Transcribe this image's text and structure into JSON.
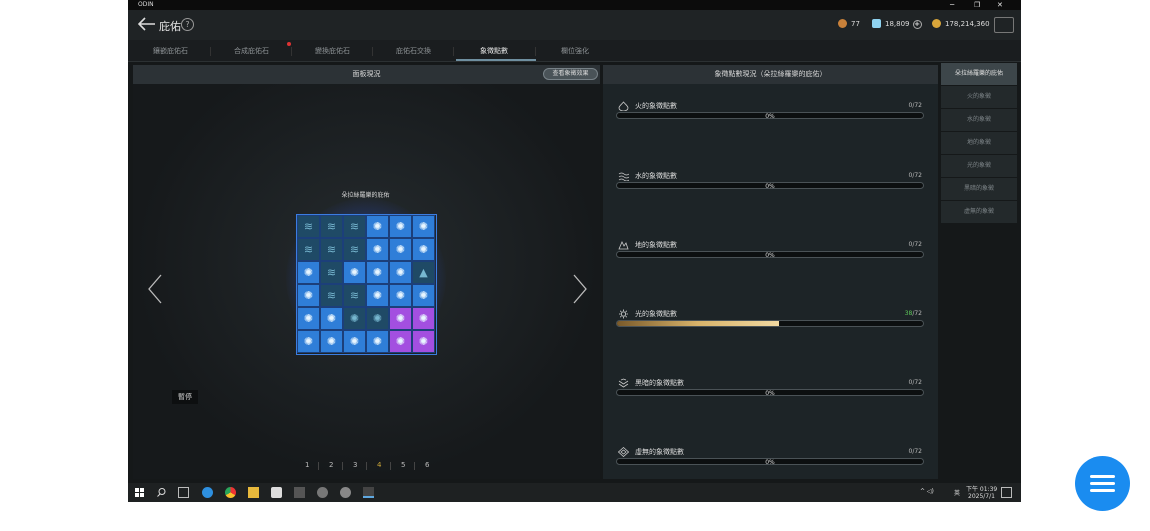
{
  "window": {
    "app_title": "ODIN",
    "min": "─",
    "restore": "❐",
    "close": "✕"
  },
  "header": {
    "title": "庇佑",
    "help": "?"
  },
  "currency": {
    "ore": "77",
    "diamond": "18,809",
    "gold": "178,214,360",
    "plus": "+"
  },
  "tabs": [
    "鑲嵌庇佑石",
    "合成庇佑石",
    "變換庇佑石",
    "庇佑石交換",
    "象徵點數",
    "欄位強化"
  ],
  "left_panel": {
    "title": "面板現況",
    "view_button": "查看象徵效果",
    "board_title": "朵拉絲羅樂的庇佑",
    "pause_label": "暫停",
    "board": [
      [
        "w",
        "w",
        "w",
        "s",
        "s",
        "s"
      ],
      [
        "w",
        "w",
        "w",
        "s",
        "s",
        "s"
      ],
      [
        "s",
        "w",
        "s",
        "s",
        "s",
        "e"
      ],
      [
        "s",
        "w",
        "w",
        "s",
        "s",
        "s"
      ],
      [
        "s",
        "s",
        "s",
        "s",
        "s",
        "s"
      ],
      [
        "s",
        "s",
        "s",
        "s",
        "s",
        "s"
      ]
    ],
    "board_colors": [
      [
        "d",
        "d",
        "d",
        "b",
        "b",
        "b"
      ],
      [
        "d",
        "d",
        "d",
        "b",
        "b",
        "b"
      ],
      [
        "b",
        "d",
        "b",
        "b",
        "b",
        "d"
      ],
      [
        "b",
        "d",
        "d",
        "b",
        "b",
        "b"
      ],
      [
        "b",
        "b",
        "d",
        "d",
        "p",
        "p"
      ],
      [
        "b",
        "b",
        "b",
        "b",
        "p",
        "p"
      ]
    ],
    "pages": [
      "1",
      "2",
      "3",
      "4",
      "5",
      "6"
    ],
    "current_page": "4"
  },
  "right_panel": {
    "title": "象徵點數現況（朵拉絲羅樂的庇佑）",
    "rows": [
      {
        "label": "火的象徵點數",
        "value": "0",
        "max": "/72",
        "percent": "0%",
        "fill": 0,
        "icon": "fire-icon"
      },
      {
        "label": "水的象徵點數",
        "value": "0",
        "max": "/72",
        "percent": "0%",
        "fill": 0,
        "icon": "water-icon"
      },
      {
        "label": "地的象徵點數",
        "value": "0",
        "max": "/72",
        "percent": "0%",
        "fill": 0,
        "icon": "earth-icon"
      },
      {
        "label": "光的象徵點數",
        "value": "38",
        "max": "/72",
        "percent": "",
        "fill": 0.53,
        "icon": "sun-icon"
      },
      {
        "label": "黑暗的象徵點數",
        "value": "0",
        "max": "/72",
        "percent": "0%",
        "fill": 0,
        "icon": "dark-icon"
      },
      {
        "label": "虛無的象徵點數",
        "value": "0",
        "max": "/72",
        "percent": "0%",
        "fill": 0,
        "icon": "void-icon"
      }
    ]
  },
  "sidebar": [
    "朵拉絲羅樂的庇佑",
    "火的象徵",
    "水的象徵",
    "地的象徵",
    "光的象徵",
    "黑暗的象徵",
    "虛無的象徵"
  ],
  "taskbar": {
    "time": "下午 01:39",
    "date": "2025/7/1",
    "lang": "英"
  }
}
